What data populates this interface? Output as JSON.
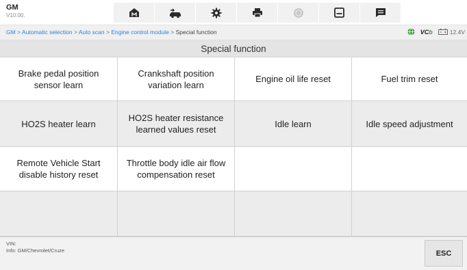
{
  "app": {
    "brand": "GM",
    "version": "V10.00."
  },
  "toolbar": {
    "buttons": [
      {
        "icon": "home-icon"
      },
      {
        "icon": "vehicle-swap-icon"
      },
      {
        "icon": "settings-gear-icon"
      },
      {
        "icon": "print-icon"
      },
      {
        "icon": "help-icon"
      },
      {
        "icon": "save-icon"
      },
      {
        "icon": "message-icon"
      }
    ]
  },
  "breadcrumb": {
    "path": "GM > Automatic selection > Auto scan > Engine control module > ",
    "current": "Special function"
  },
  "status": {
    "vcb": "VC",
    "vcb_b": "b",
    "voltage": "12.4V"
  },
  "page_title": "Special function",
  "functions": [
    "Brake pedal position sensor learn",
    "Crankshaft position variation learn",
    "Engine oil life reset",
    "Fuel trim reset",
    "HO2S heater learn",
    "HO2S heater resistance learned values reset",
    "Idle learn",
    "Idle speed adjustment",
    "Remote Vehicle Start disable history reset",
    "Throttle body idle air flow compensation reset",
    "",
    "",
    "",
    "",
    "",
    ""
  ],
  "footer": {
    "vin_label": "VIN:",
    "info": "Info: GM/Chevrolet/Cruze",
    "esc_label": "ESC"
  }
}
